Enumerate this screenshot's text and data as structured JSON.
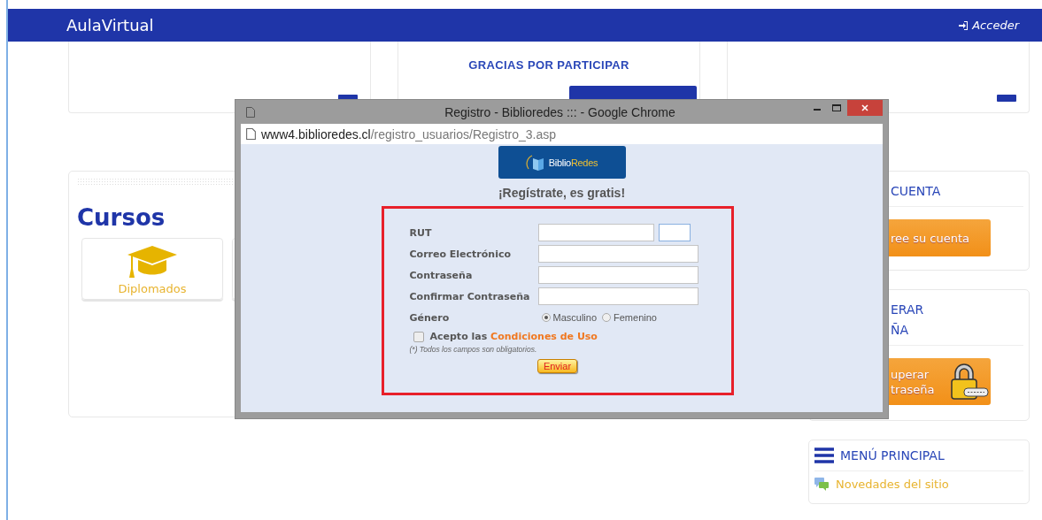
{
  "header": {
    "brand": "AulaVirtual",
    "login": "Acceder"
  },
  "top_cards": [
    {
      "kind": "blank"
    },
    {
      "kind": "notice",
      "text": "GRACIAS POR PARTICIPAR"
    },
    {
      "kind": "blank"
    }
  ],
  "courses": {
    "title": "Cursos",
    "tiles": [
      {
        "label": "Diplomados"
      }
    ]
  },
  "sidebar": {
    "account": {
      "title": "CUENTA",
      "button": "ree su cuenta"
    },
    "recover": {
      "title_lines": [
        "ERAR",
        "ÑA"
      ],
      "button_lines": [
        "uperar",
        "traseña"
      ]
    },
    "menu": {
      "title": "MENÚ PRINCIPAL",
      "items": [
        "Novedades del sitio"
      ]
    }
  },
  "popup": {
    "title": "Registro - Biblioredes ::: - Google Chrome",
    "url_host": "www4.biblioredes.cl",
    "url_path": "/registro_usuarios/Registro_3.asp",
    "logo": {
      "part1": "Biblio",
      "part2": "Redes"
    },
    "heading": "¡Regístrate, es gratis!",
    "fields": [
      {
        "label": "RUT",
        "kind": "rut"
      },
      {
        "label": "Correo Electrónico",
        "kind": "text"
      },
      {
        "label": "Contraseña",
        "kind": "text"
      },
      {
        "label": "Confirmar Contraseña",
        "kind": "text"
      },
      {
        "label": "Género",
        "kind": "radio",
        "options": [
          {
            "label": "Masculino",
            "selected": true
          },
          {
            "label": "Femenino",
            "selected": false
          }
        ]
      }
    ],
    "terms": {
      "checked": false,
      "text": "Acepto las",
      "link": "Condiciones de Uso"
    },
    "note": "(*) Todos los campos son obligatorios.",
    "submit": "Enviar"
  }
}
